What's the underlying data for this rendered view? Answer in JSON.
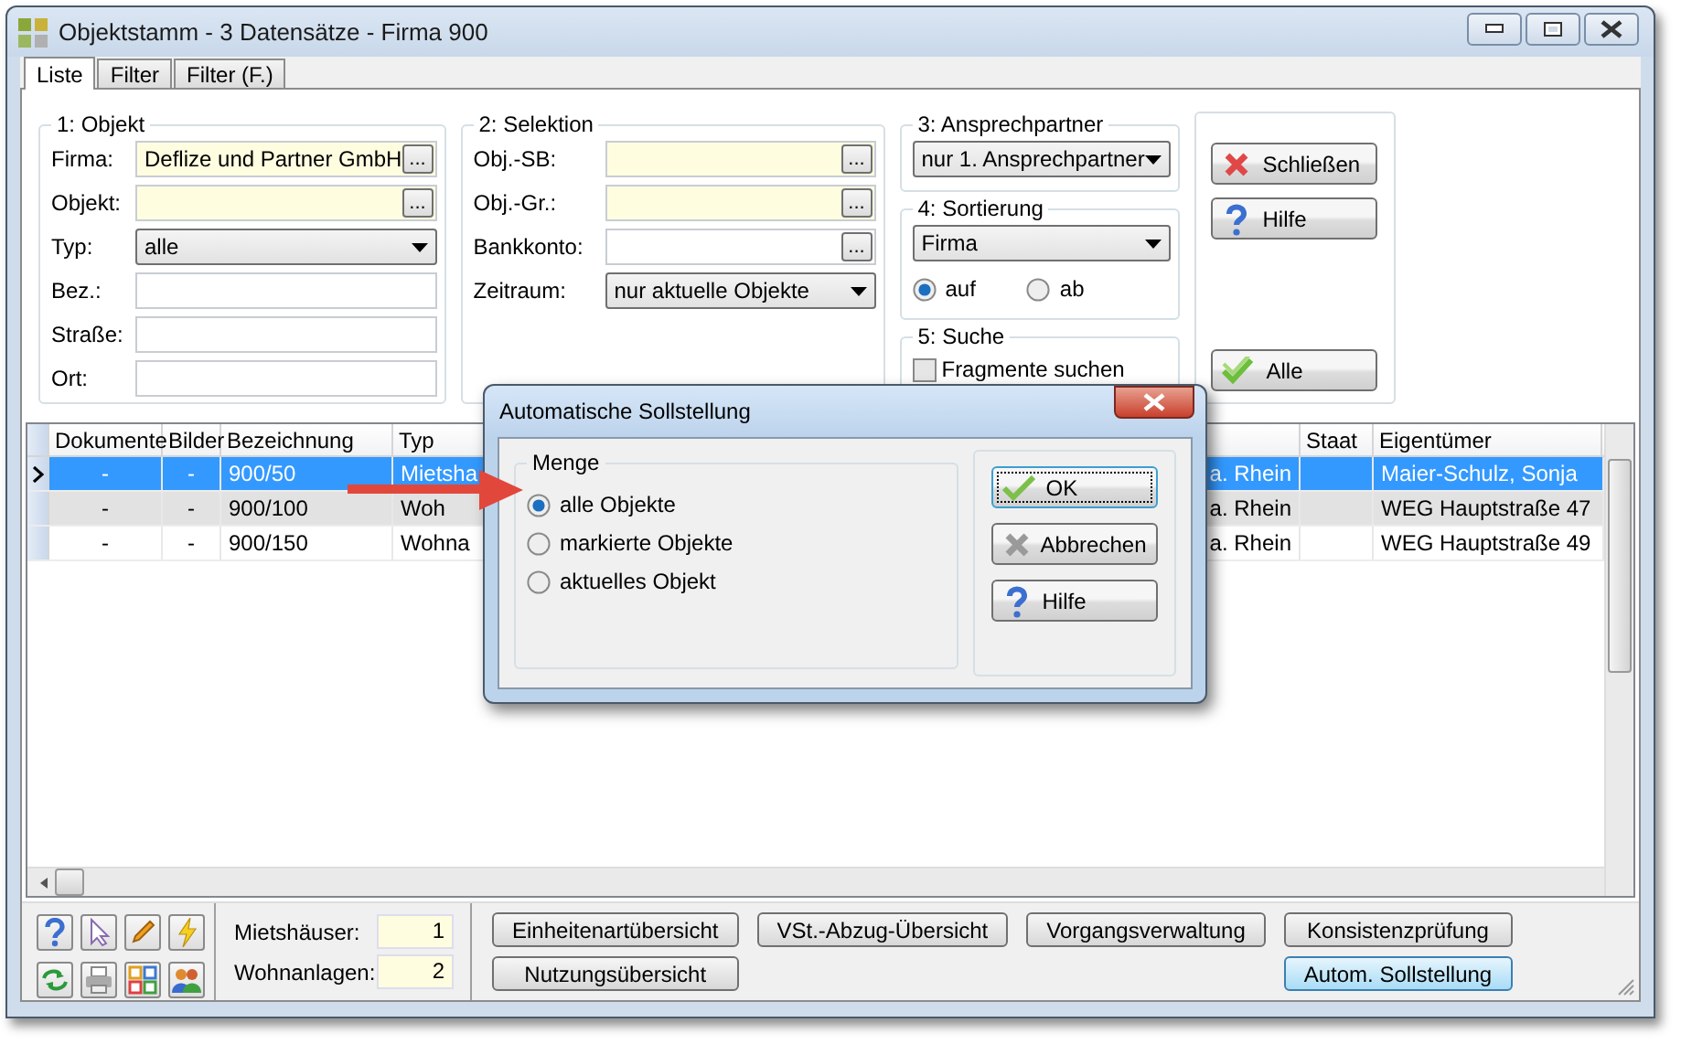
{
  "window": {
    "title": "Objektstamm - 3 Datensätze - Firma 900"
  },
  "tabs": [
    {
      "label": "Liste",
      "selected": true
    },
    {
      "label": "Filter",
      "selected": false
    },
    {
      "label": "Filter (F.)",
      "selected": false
    }
  ],
  "objekt": {
    "title": "1: Objekt",
    "fields": [
      {
        "label": "Firma:",
        "kind": "lookup",
        "highlighted": true,
        "value": "Deflize und Partner GmbH",
        "button": "..."
      },
      {
        "label": "Objekt:",
        "kind": "lookup",
        "highlighted": true,
        "button": "..."
      },
      {
        "label": "Typ:",
        "kind": "dropdown",
        "value": "alle"
      },
      {
        "label": "Bez.:",
        "kind": "text"
      },
      {
        "label": "Straße:",
        "kind": "text"
      },
      {
        "label": "Ort:",
        "kind": "text"
      }
    ]
  },
  "selektion": {
    "title": "2: Selektion",
    "fields": [
      {
        "label": "Obj.-SB:",
        "kind": "lookup",
        "highlighted": true,
        "button": "..."
      },
      {
        "label": "Obj.-Gr.:",
        "kind": "lookup",
        "highlighted": true,
        "button": "..."
      },
      {
        "label": "Bankkonto:",
        "kind": "lookup",
        "highlighted": false,
        "button": "..."
      },
      {
        "label": "Zeitraum:",
        "kind": "dropdown",
        "value": "nur aktuelle Objekte"
      }
    ]
  },
  "ansprechpartner": {
    "title": "3: Ansprechpartner",
    "value": "nur 1. Ansprechpartner"
  },
  "sortierung": {
    "title": "4: Sortierung",
    "value": "Firma",
    "options": [
      {
        "label": "auf",
        "selected": true
      },
      {
        "label": "ab",
        "selected": false
      }
    ]
  },
  "suche": {
    "title": "5: Suche",
    "checkbox": {
      "label": "Fragmente suchen",
      "checked": false
    }
  },
  "side_buttons": [
    {
      "label": "Schließen",
      "kind": "close"
    },
    {
      "label": "Hilfe",
      "kind": "help"
    },
    {
      "label": "Alle",
      "kind": "all"
    }
  ],
  "table": {
    "columns": [
      {
        "label": "Dokumente"
      },
      {
        "label": "Bilder"
      },
      {
        "label": "Bezeichnung"
      },
      {
        "label": "Typ"
      },
      {
        "kind": "covered"
      },
      {
        "label": "Staat"
      },
      {
        "label": "Eigentümer"
      }
    ],
    "rows": [
      {
        "selected": true,
        "cells": [
          "-",
          "-",
          "900/50",
          "Mietsha",
          "a. Rhein",
          null,
          "Maier-Schulz, Sonja"
        ]
      },
      {
        "selected": false,
        "cells": [
          "-",
          "-",
          "900/100",
          "Woh",
          "a. Rhein",
          null,
          "WEG Hauptstraße 47"
        ]
      },
      {
        "selected": false,
        "cells": [
          "-",
          "-",
          "900/150",
          "Wohna",
          "a. Rhein",
          null,
          "WEG Hauptstraße 49"
        ]
      }
    ]
  },
  "counts": [
    {
      "label": "Mietshäuser:",
      "value": "1"
    },
    {
      "label": "Wohnanlagen:",
      "value": "2"
    }
  ],
  "bottom_buttons": [
    [
      {
        "label": "Einheitenartübersicht",
        "focused": false
      },
      {
        "label": "Nutzungsübersicht",
        "focused": false
      }
    ],
    [
      {
        "label": "VSt.-Abzug-Übersicht",
        "focused": false
      }
    ],
    [
      {
        "label": "Vorgangsverwaltung",
        "focused": false
      }
    ],
    [
      {
        "label": "Konsistenzprüfung",
        "focused": false
      },
      {
        "label": "Autom. Sollstellung",
        "focused": true
      }
    ]
  ],
  "dialog": {
    "title": "Automatische Sollstellung",
    "group": "Menge",
    "options": [
      {
        "label": "alle Objekte",
        "selected": true
      },
      {
        "label": "markierte Objekte",
        "selected": false
      },
      {
        "label": "aktuelles Objekt",
        "selected": false
      }
    ],
    "buttons": [
      {
        "label": "OK",
        "kind": "ok",
        "focused": true
      },
      {
        "label": "Abbrechen",
        "kind": "cancel",
        "focused": false
      },
      {
        "label": "Hilfe",
        "kind": "help",
        "focused": false
      }
    ]
  }
}
